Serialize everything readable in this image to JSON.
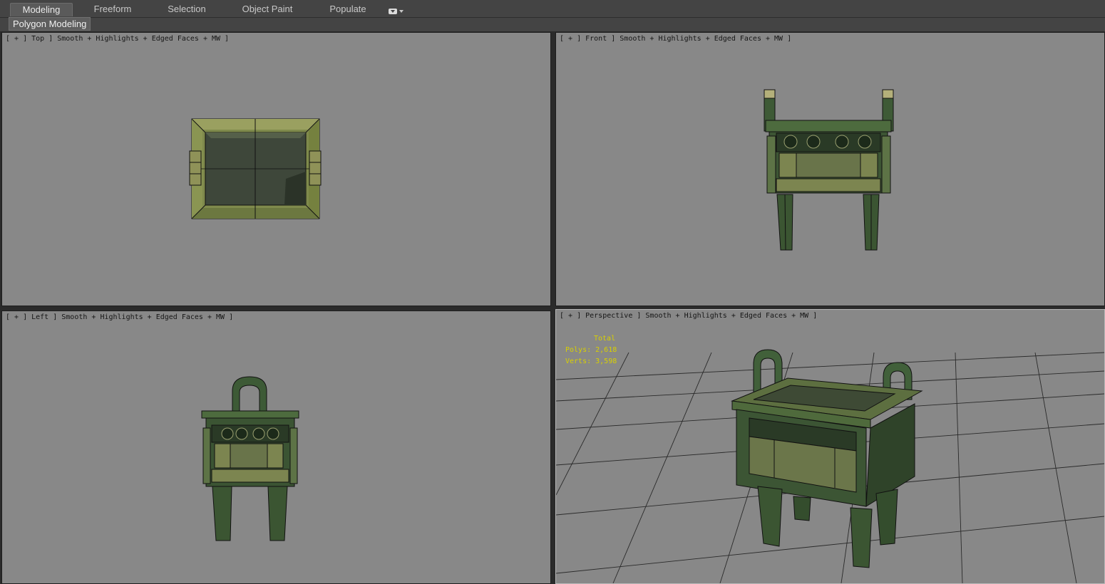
{
  "ribbon": {
    "tabs": [
      {
        "label": "Modeling",
        "active": true
      },
      {
        "label": "Freeform"
      },
      {
        "label": "Selection"
      },
      {
        "label": "Object Paint"
      },
      {
        "label": "Populate"
      }
    ],
    "more_icon": "dropdown-pill-icon",
    "panel_label": "Polygon Modeling"
  },
  "viewports": {
    "top": {
      "label": "[ + ] Top ] Smooth + Highlights + Edged Faces + MW ]"
    },
    "front": {
      "label": "[ + ] Front ] Smooth + Highlights + Edged Faces + MW ]"
    },
    "left": {
      "label": "[ + ] Left ] Smooth + Highlights + Edged Faces + MW ]"
    },
    "perspective": {
      "label": "[ + ] Perspective ] Smooth + Highlights + Edged Faces + MW ]"
    }
  },
  "stats": {
    "title": "Total",
    "polys": "Polys: 2,618",
    "verts": "Verts: 3,598"
  },
  "colors": {
    "viewport_bg": "#888888",
    "bronze_dark": "#2f3d26",
    "bronze_light": "#8a8f52",
    "stats_text": "#d8d000"
  }
}
